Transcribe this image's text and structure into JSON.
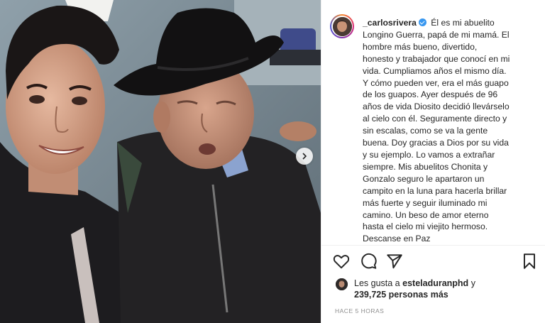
{
  "post": {
    "username": "_carlosrivera",
    "caption_lines": [
      "Él es mi abuelito",
      "Longino Guerra, papá de mi mamá. El",
      "hombre más bueno, divertido,",
      "honesto y trabajador que conocí en mi",
      "vida. Cumpliamos años el mismo día.",
      "Y cómo pueden ver, era el más guapo",
      "de los guapos. Ayer después de 96",
      "años de vida Diosito decidió llevárselo",
      "al cielo con él. Seguramente directo y",
      "sin escalas, como se va la gente",
      "buena. Doy gracias a Dios por su vida",
      "y su ejemplo. Lo vamos a extrañar",
      "siempre. Mis abuelitos Chonita y",
      "Gonzalo seguro le apartaron un",
      "campito en la luna para hacerla brillar",
      "más fuerte y seguir iluminado mi",
      "camino. Un beso de amor eterno",
      "hasta el cielo mi viejito hermoso.",
      "Descanse en Paz"
    ],
    "likes_prefix": "Les gusta a",
    "liker_username": "esteladuranphd",
    "likes_conj": "y",
    "likes_count": "239,725 personas más",
    "timestamp": "HACE 5 HORAS"
  },
  "icons": {
    "like": "heart-icon",
    "comment": "comment-icon",
    "share": "paper-plane-icon",
    "save": "bookmark-icon",
    "carousel": "chevron-right-icon",
    "verified": "verified-badge-icon"
  },
  "colors": {
    "text": "#262626",
    "muted": "#8e8e8e",
    "verified": "#3897f0",
    "divider": "#efefef"
  }
}
